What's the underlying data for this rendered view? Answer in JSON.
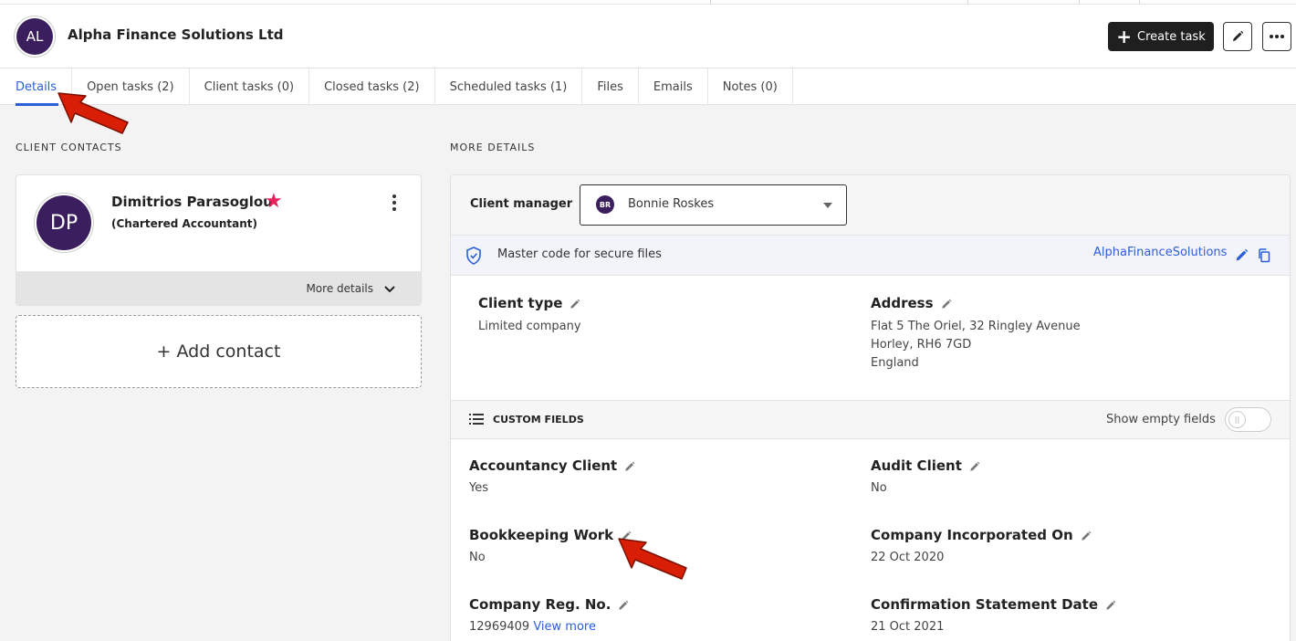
{
  "header": {
    "avatar_initials": "AL",
    "client_name": "Alpha Finance Solutions Ltd",
    "create_task_label": "Create task"
  },
  "tabs": [
    {
      "label": "Details",
      "active": true
    },
    {
      "label": "Open tasks (2)"
    },
    {
      "label": "Client tasks (0)"
    },
    {
      "label": "Closed tasks (2)"
    },
    {
      "label": "Scheduled tasks (1)"
    },
    {
      "label": "Files"
    },
    {
      "label": "Emails"
    },
    {
      "label": "Notes (0)"
    }
  ],
  "client_contacts": {
    "section_title": "CLIENT CONTACTS",
    "contact": {
      "initials": "DP",
      "name": "Dimitrios Parasoglou",
      "role": "(Chartered Accountant)",
      "more_details_label": "More details"
    },
    "add_contact_label": "+ Add contact"
  },
  "more_details": {
    "section_title": "MORE DETAILS",
    "client_manager_label": "Client manager",
    "client_manager_initials": "BR",
    "client_manager_value": "Bonnie Roskes",
    "master_code_label": "Master code for secure files",
    "master_code_value": "AlphaFinanceSolutions",
    "client_type_label": "Client type",
    "client_type_value": "Limited company",
    "address_label": "Address",
    "address_lines": [
      "Flat 5 The Oriel, 32 Ringley Avenue",
      "Horley, RH6 7GD",
      "England"
    ],
    "custom_fields_label": "CUSTOM FIELDS",
    "show_empty_label": "Show empty fields",
    "fields": {
      "accountancy_client": {
        "label": "Accountancy Client",
        "value": "Yes"
      },
      "audit_client": {
        "label": "Audit Client",
        "value": "No"
      },
      "bookkeeping_work": {
        "label": "Bookkeeping Work",
        "value": "No"
      },
      "company_incorporated_on": {
        "label": "Company Incorporated On",
        "value": "22 Oct 2020"
      },
      "company_reg_no": {
        "label": "Company Reg. No.",
        "value": "12969409",
        "link": "View more"
      },
      "confirmation_statement_date": {
        "label": "Confirmation Statement Date",
        "value": "21 Oct 2021"
      }
    }
  },
  "colors": {
    "accent_blue": "#2b5fd9",
    "avatar_purple": "#3b1e5e",
    "star_pink": "#e8235a",
    "arrow_red": "#d81e05"
  }
}
